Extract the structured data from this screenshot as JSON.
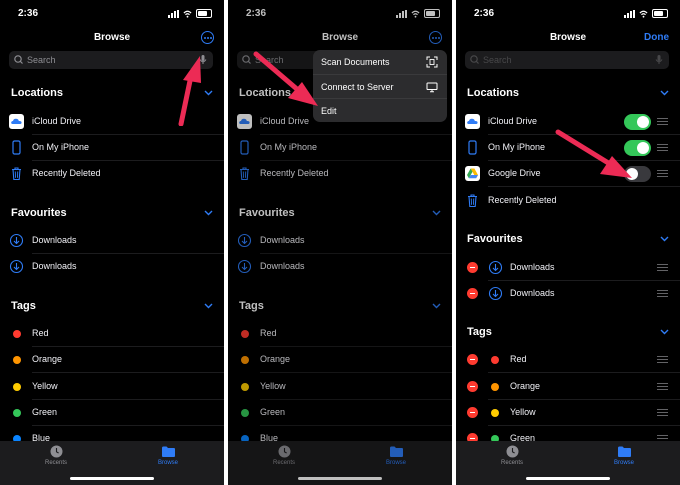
{
  "status": {
    "time": "2:36"
  },
  "nav": {
    "title": "Browse",
    "done": "Done"
  },
  "search": {
    "placeholder": "Search"
  },
  "sections": {
    "locations": "Locations",
    "favourites": "Favourites",
    "tags": "Tags"
  },
  "locations": {
    "icloud": "iCloud Drive",
    "iphone": "On My iPhone",
    "google": "Google Drive",
    "deleted": "Recently Deleted"
  },
  "favourites": [
    "Downloads",
    "Downloads"
  ],
  "tags": [
    {
      "label": "Red",
      "color": "#ff3b30"
    },
    {
      "label": "Orange",
      "color": "#ff9500"
    },
    {
      "label": "Yellow",
      "color": "#ffcc00"
    },
    {
      "label": "Green",
      "color": "#34c759"
    },
    {
      "label": "Blue",
      "color": "#0a84ff"
    }
  ],
  "menu": {
    "scan": "Scan Documents",
    "connect": "Connect to Server",
    "edit": "Edit"
  },
  "tabs": {
    "recents": "Recents",
    "browse": "Browse"
  },
  "toggles": {
    "icloud": true,
    "iphone": true,
    "google": false
  },
  "colors": {
    "accent": "#2f7cf6",
    "arrow": "#ec2b55",
    "toggle_on": "#34c759"
  }
}
